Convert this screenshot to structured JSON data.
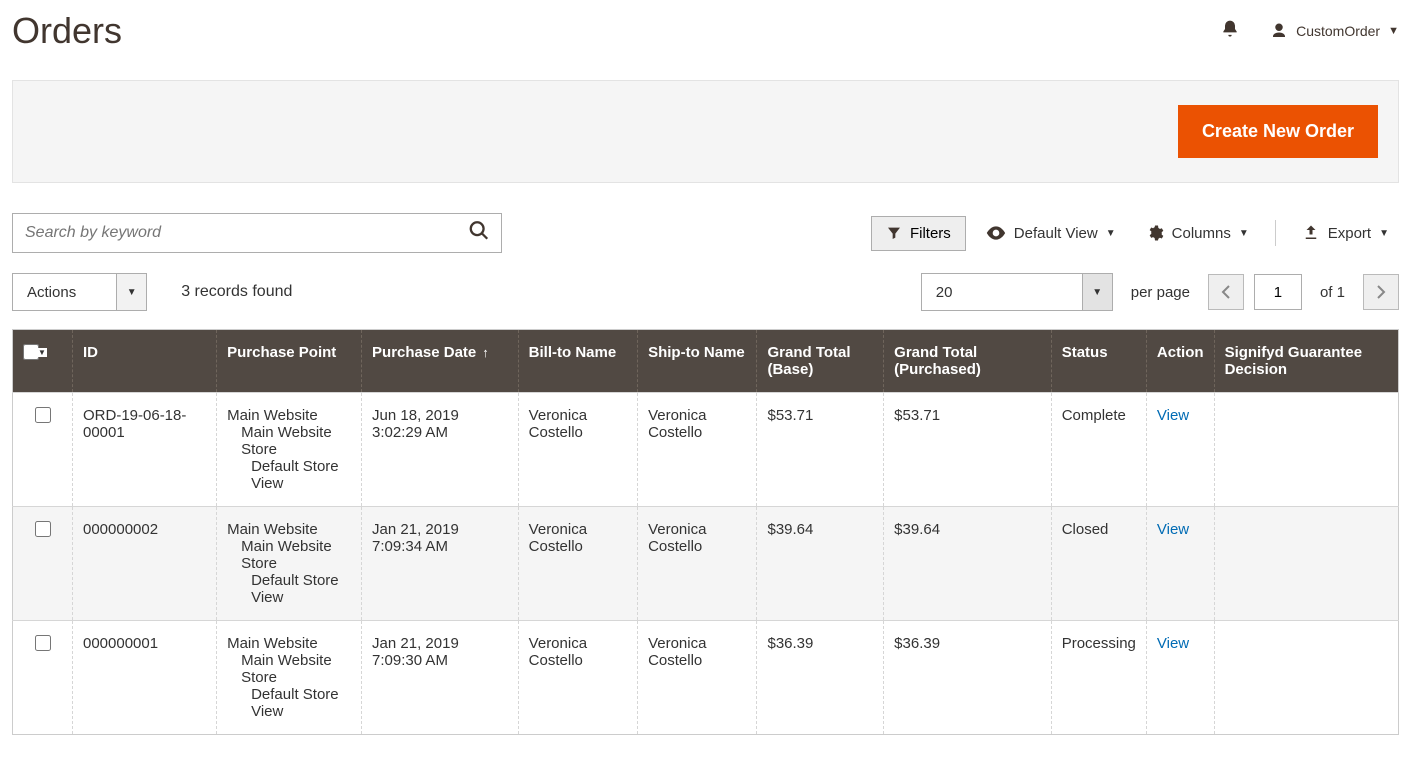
{
  "header": {
    "title": "Orders",
    "username": "CustomOrder"
  },
  "primary_action": {
    "label": "Create New Order"
  },
  "search": {
    "placeholder": "Search by keyword"
  },
  "toolbar": {
    "filters": "Filters",
    "default_view": "Default View",
    "columns": "Columns",
    "export": "Export"
  },
  "actions_label": "Actions",
  "records_found": "3 records found",
  "per_page": {
    "value": "20",
    "label": "per page"
  },
  "pagination": {
    "current": "1",
    "of_label": "of",
    "total": "1"
  },
  "columns": {
    "id": "ID",
    "purchase_point": "Purchase Point",
    "purchase_date": "Purchase Date",
    "bill_to": "Bill-to Name",
    "ship_to": "Ship-to Name",
    "gt_base": "Grand Total (Base)",
    "gt_purchased": "Grand Total (Purchased)",
    "status": "Status",
    "action": "Action",
    "signifyd": "Signifyd Guarantee Decision"
  },
  "purchase_point_lines": {
    "l1": "Main Website",
    "l2": "Main Website Store",
    "l3": "Default Store View"
  },
  "view_label": "View",
  "rows": [
    {
      "id": "ORD-19-06-18-00001",
      "date": "Jun 18, 2019 3:02:29 AM",
      "bill": "Veronica Costello",
      "ship": "Veronica Costello",
      "gtb": "$53.71",
      "gtp": "$53.71",
      "status": "Complete"
    },
    {
      "id": "000000002",
      "date": "Jan 21, 2019 7:09:34 AM",
      "bill": "Veronica Costello",
      "ship": "Veronica Costello",
      "gtb": "$39.64",
      "gtp": "$39.64",
      "status": "Closed"
    },
    {
      "id": "000000001",
      "date": "Jan 21, 2019 7:09:30 AM",
      "bill": "Veronica Costello",
      "ship": "Veronica Costello",
      "gtb": "$36.39",
      "gtp": "$36.39",
      "status": "Processing"
    }
  ]
}
